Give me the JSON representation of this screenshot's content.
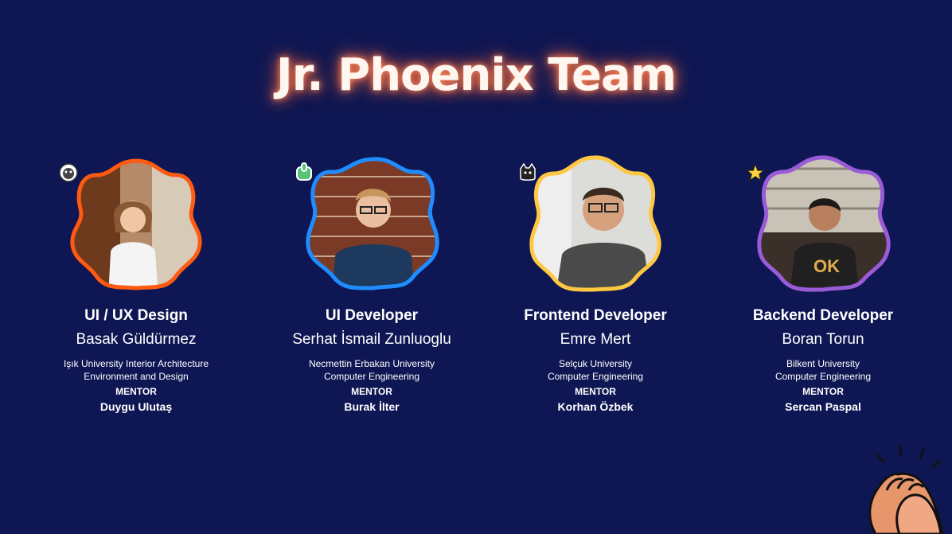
{
  "title": "Jr. Phoenix Team",
  "members": [
    {
      "role": "UI / UX Design",
      "name": "Basak Güldürmez",
      "school": "Işık University Interior Architecture\nEnvironment and Design",
      "mentor_label": "MENTOR",
      "mentor": "Duygu Ulutaş",
      "frame_color": "#ff5a12",
      "sticker_icon": "monkey-face-icon"
    },
    {
      "role": "UI Developer",
      "name": "Serhat İsmail Zunluoglu",
      "school": "Necmettin Erbakan University\nComputer Engineering",
      "mentor_label": "MENTOR",
      "mentor": "Burak İlter",
      "frame_color": "#1f8cff",
      "sticker_icon": "green-hand-icon"
    },
    {
      "role": "Frontend Developer",
      "name": "Emre Mert",
      "school": "Selçuk University\nComputer Engineering",
      "mentor_label": "MENTOR",
      "mentor": "Korhan Özbek",
      "frame_color": "#ffc843",
      "sticker_icon": "cat-face-icon"
    },
    {
      "role": "Backend Developer",
      "name": "Boran Torun",
      "school": "Bilkent University\nComputer Engineering",
      "mentor_label": "MENTOR",
      "mentor": "Sercan Paspal",
      "frame_color": "#9a5bd6",
      "sticker_icon": "star-icon"
    }
  ],
  "decoration_icon": "clapping-hands-icon"
}
